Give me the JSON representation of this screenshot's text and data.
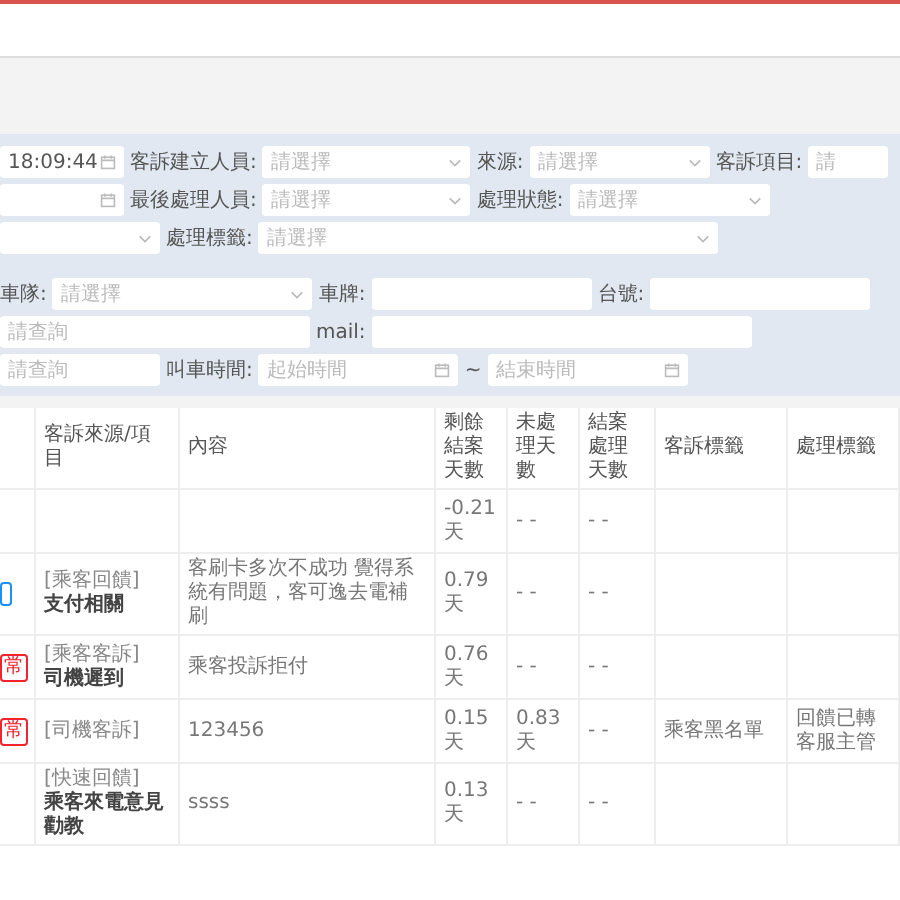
{
  "filters": [
    [
      {
        "kind": "date",
        "value": "18:09:44"
      },
      {
        "kind": "label",
        "text": "客訴建立人員:"
      },
      {
        "kind": "select",
        "placeholder": "請選擇"
      },
      {
        "kind": "label",
        "text": "來源:"
      },
      {
        "kind": "select",
        "placeholder": "請選擇"
      },
      {
        "kind": "label",
        "text": "客訴項目:"
      },
      {
        "kind": "select",
        "placeholder": "請"
      }
    ],
    [
      {
        "kind": "date"
      },
      {
        "kind": "label",
        "text": "最後處理人員:"
      },
      {
        "kind": "select",
        "placeholder": "請選擇"
      },
      {
        "kind": "label",
        "text": "處理狀態:"
      },
      {
        "kind": "select",
        "placeholder": "請選擇"
      }
    ],
    [
      {
        "kind": "select"
      },
      {
        "kind": "label",
        "text": "處理標籤:"
      },
      {
        "kind": "select",
        "placeholder": "請選擇"
      }
    ]
  ],
  "filters2": [
    [
      {
        "kind": "label",
        "text": "車隊:"
      },
      {
        "kind": "select",
        "placeholder": "請選擇"
      },
      {
        "kind": "label",
        "text": "車牌:"
      },
      {
        "kind": "input"
      },
      {
        "kind": "label",
        "text": "台號:"
      },
      {
        "kind": "input"
      }
    ],
    [
      {
        "kind": "input",
        "placeholder": "請查詢"
      },
      {
        "kind": "label",
        "text": "mail:"
      },
      {
        "kind": "input"
      }
    ],
    [
      {
        "kind": "input",
        "placeholder": "請查詢"
      },
      {
        "kind": "label",
        "text": "叫車時間:"
      },
      {
        "kind": "date",
        "placeholder": "起始時間"
      },
      {
        "kind": "label",
        "text": "~"
      },
      {
        "kind": "date",
        "placeholder": "結束時間"
      }
    ]
  ],
  "table": {
    "columns": [
      "客訴來源/項目",
      "內容",
      "剩餘結案天數",
      "未處理天數",
      "結案處理天數",
      "客訴標籤",
      "處理標籤"
    ],
    "rows": [
      {
        "remaining": "-0.21 天",
        "unhandled": "- -",
        "closed": "- -"
      },
      {
        "tag": {
          "color": "#1890ff"
        },
        "source": "[乘客回饋]",
        "item": "支付相關",
        "content": "客刷卡多次不成功 覺得系統有問題，客可逸去電補刷",
        "remaining": "0.79 天",
        "unhandled": "- -",
        "closed": "- -"
      },
      {
        "tag": {
          "text": "常",
          "color": "#f5222d"
        },
        "source": "[乘客客訴]",
        "item": "司機遲到",
        "content": "乘客投訴拒付",
        "remaining": "0.76 天",
        "unhandled": "- -",
        "closed": "- -"
      },
      {
        "tag": {
          "text": "常",
          "color": "#f5222d"
        },
        "source": "[司機客訴]",
        "content": "123456",
        "remaining": "0.15 天",
        "unhandled": "0.83 天",
        "closed": "- -",
        "complaint_tag": "乘客黑名單",
        "handle_tag": "回饋已轉客服主管"
      },
      {
        "source": "[快速回饋]",
        "item": "乘客來電意見勸教",
        "content": "ssss",
        "remaining": "0.13 天",
        "unhandled": "- -",
        "closed": "- -"
      }
    ]
  }
}
